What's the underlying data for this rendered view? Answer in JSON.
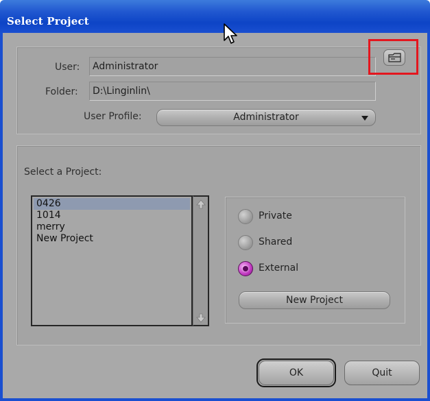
{
  "window": {
    "title": "Select Project"
  },
  "account": {
    "user_label": "User:",
    "user_value": "Administrator",
    "folder_label": "Folder:",
    "folder_value": "D:\\Linginlin\\",
    "profile_label": "User Profile:",
    "profile_value": "Administrator",
    "browse_icon": "folder-browse-icon"
  },
  "projects": {
    "heading": "Select a Project:",
    "items": [
      "0426",
      "1014",
      "merry",
      "New Project"
    ],
    "selected": "0426"
  },
  "project_type": {
    "options": [
      "Private",
      "Shared",
      "External"
    ],
    "selected": "External",
    "new_project_label": "New Project"
  },
  "buttons": {
    "ok": "OK",
    "quit": "Quit"
  },
  "colors": {
    "highlight": "#e4161e",
    "selected_radio": "#c23ac2",
    "title_bar": "#1a4fd0"
  }
}
